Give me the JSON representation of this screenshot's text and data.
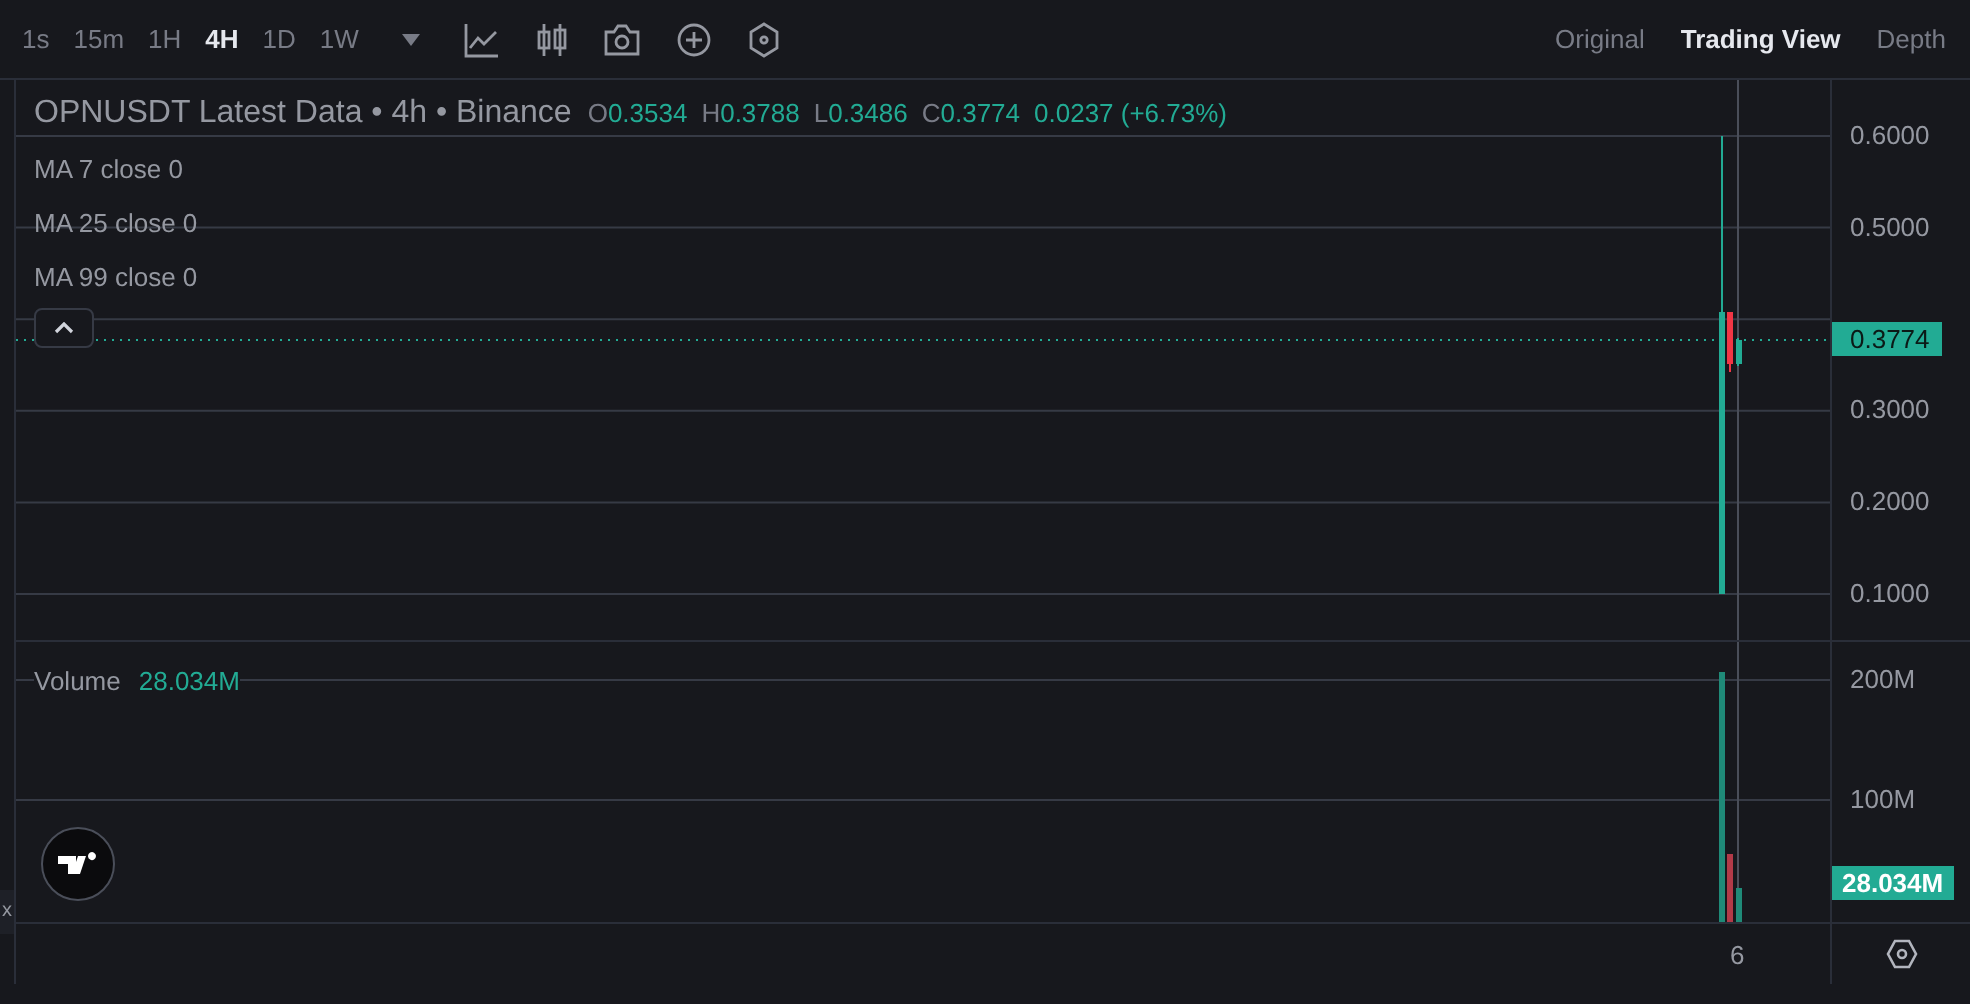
{
  "toolbar": {
    "intervals": [
      {
        "label": "1s",
        "selected": false
      },
      {
        "label": "15m",
        "selected": false
      },
      {
        "label": "1H",
        "selected": false
      },
      {
        "label": "4H",
        "selected": true
      },
      {
        "label": "1D",
        "selected": false
      },
      {
        "label": "1W",
        "selected": false
      }
    ],
    "view_tabs": [
      {
        "label": "Original",
        "selected": false
      },
      {
        "label": "Trading View",
        "selected": true
      },
      {
        "label": "Depth",
        "selected": false
      }
    ]
  },
  "legend": {
    "title": "OPNUSDT Latest Data • 4h • Binance",
    "ohlc": [
      {
        "label": "O",
        "value": "0.3534"
      },
      {
        "label": "H",
        "value": "0.3788"
      },
      {
        "label": "L",
        "value": "0.3486"
      },
      {
        "label": "C",
        "value": "0.3774"
      }
    ],
    "change": "0.0237 (+6.73%)",
    "indicators": [
      "MA 7 close 0",
      "MA 25 close 0",
      "MA 99 close 0"
    ]
  },
  "price_axis": {
    "ticks": [
      "0.6000",
      "0.5000",
      "0.3000",
      "0.2000",
      "0.1000"
    ],
    "last_price": "0.3774"
  },
  "volume": {
    "label": "Volume",
    "value": "28.034M",
    "ticks": [
      "200M",
      "100M"
    ],
    "last_volume": "28.034M"
  },
  "time_axis": {
    "ticks": [
      "6"
    ]
  },
  "side_tab": "x"
}
